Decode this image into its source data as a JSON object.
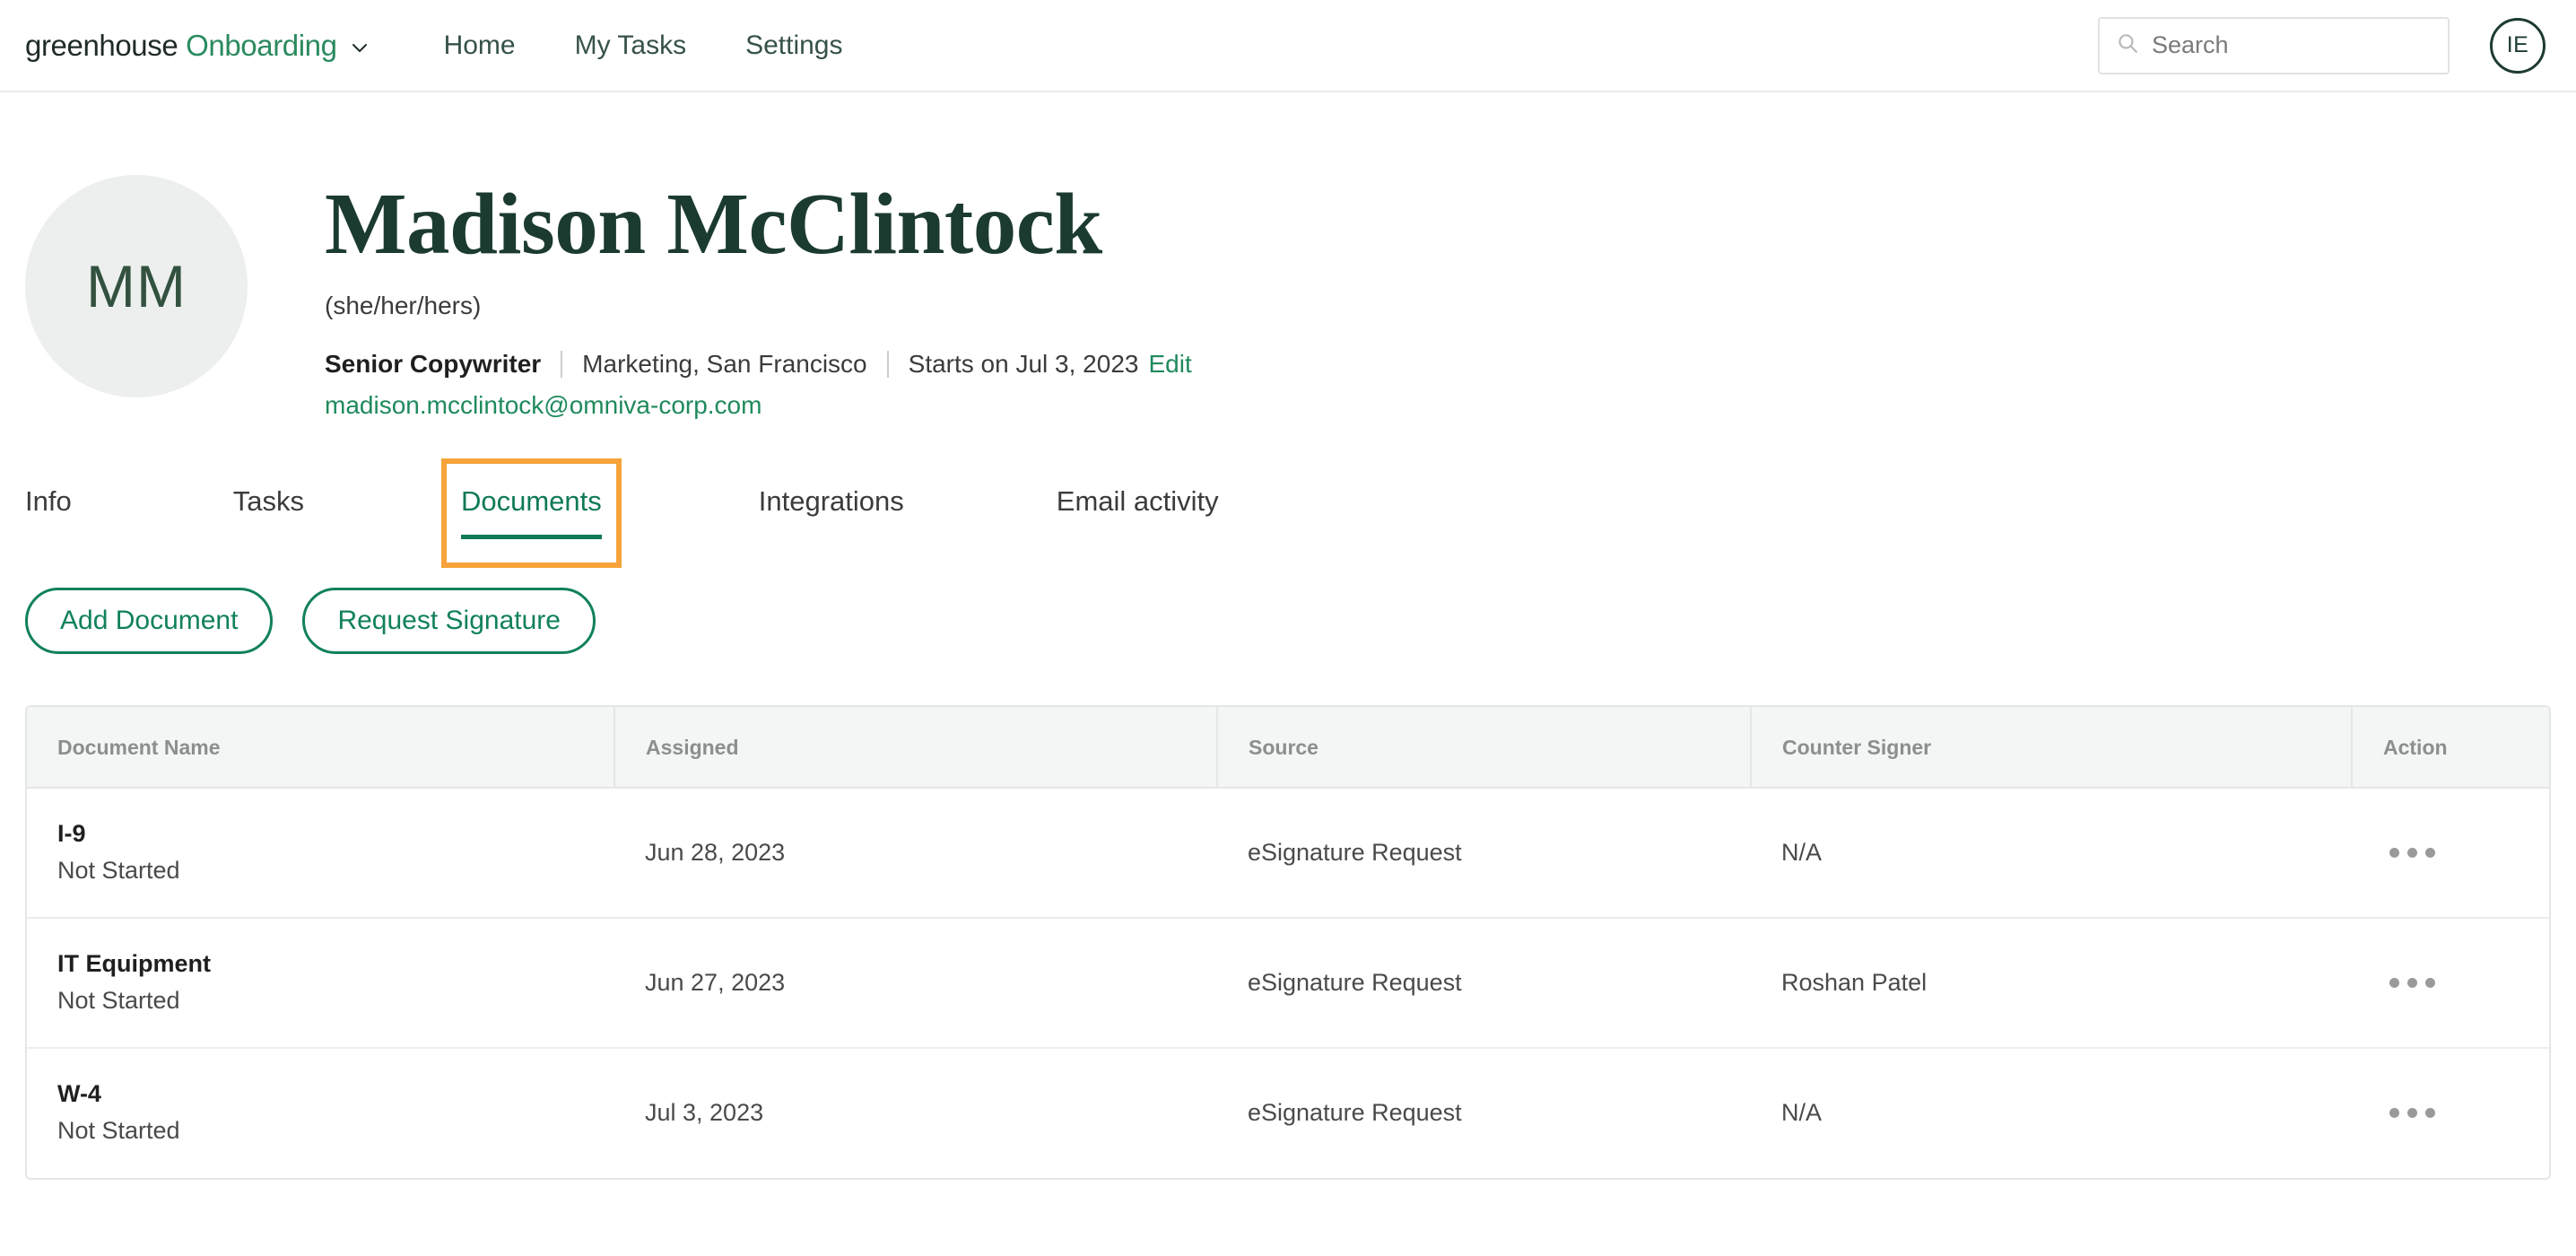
{
  "topbar": {
    "brand_primary": "greenhouse",
    "brand_secondary": "Onboarding",
    "brand_caret_icon": "chevron-down-icon",
    "nav": [
      {
        "label": "Home"
      },
      {
        "label": "My Tasks"
      },
      {
        "label": "Settings"
      }
    ],
    "search": {
      "icon": "search-icon",
      "placeholder": "Search",
      "value": ""
    },
    "user_initials": "IE"
  },
  "profile": {
    "avatar_initials": "MM",
    "name": "Madison McClintock",
    "pronouns": "(she/her/hers)",
    "title": "Senior Copywriter",
    "department_location": "Marketing, San Francisco",
    "start_date": "Starts on Jul 3, 2023",
    "edit_label": "Edit",
    "email": "madison.mcclintock@omniva-corp.com"
  },
  "tabs": [
    {
      "label": "Info",
      "active": false
    },
    {
      "label": "Tasks",
      "active": false
    },
    {
      "label": "Documents",
      "active": true
    },
    {
      "label": "Integrations",
      "active": false
    },
    {
      "label": "Email activity",
      "active": false
    }
  ],
  "actions": {
    "add_document": "Add Document",
    "request_signature": "Request Signature"
  },
  "table": {
    "columns": [
      "Document Name",
      "Assigned",
      "Source",
      "Counter Signer",
      "Action"
    ],
    "rows": [
      {
        "document_name": "I-9",
        "status": "Not Started",
        "assigned": "Jun 28, 2023",
        "source": "eSignature Request",
        "counter_signer": "N/A",
        "action_icon": "kebab-menu-icon"
      },
      {
        "document_name": "IT Equipment",
        "status": "Not Started",
        "assigned": "Jun 27, 2023",
        "source": "eSignature Request",
        "counter_signer": "Roshan Patel",
        "action_icon": "kebab-menu-icon"
      },
      {
        "document_name": "W-4",
        "status": "Not Started",
        "assigned": "Jul 3, 2023",
        "source": "eSignature Request",
        "counter_signer": "N/A",
        "action_icon": "kebab-menu-icon"
      }
    ]
  },
  "colors": {
    "brand_green": "#2a8a5f",
    "link_green": "#1f8a5c",
    "active_tab_green": "#0f7a55",
    "annotation_orange": "#f5a33a",
    "name_dark_green": "#1c3b30"
  }
}
